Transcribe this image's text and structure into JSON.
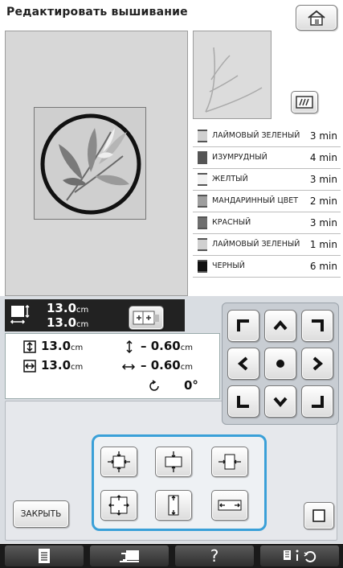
{
  "header": {
    "title": "Редактировать вышивание"
  },
  "colors": [
    {
      "name": "ЛАЙМОВЫЙ ЗЕЛЕНЫЙ",
      "time": "3 min",
      "swatch": "#d0d0d0"
    },
    {
      "name": "ИЗУМРУДНЫЙ",
      "time": "4 min",
      "swatch": "#555555"
    },
    {
      "name": "ЖЕЛТЫЙ",
      "time": "3 min",
      "swatch": "#f2f2f2"
    },
    {
      "name": "МАНДАРИННЫЙ ЦВЕТ",
      "time": "2 min",
      "swatch": "#9e9e9e"
    },
    {
      "name": "КРАСНЫЙ",
      "time": "3 min",
      "swatch": "#6e6e6e"
    },
    {
      "name": "ЛАЙМОВЫЙ ЗЕЛЕНЫЙ",
      "time": "1 min",
      "swatch": "#d0d0d0"
    },
    {
      "name": "ЧЕРНЫЙ",
      "time": "6 min",
      "swatch": "#111111"
    }
  ],
  "size": {
    "width": "13.0",
    "height": "13.0",
    "unit": "cm"
  },
  "measure": {
    "height": "13.0",
    "width": "13.0",
    "unit": "cm",
    "vertical_offset": "– 0.60",
    "horizontal_offset": "– 0.60",
    "rotation": "0°"
  },
  "buttons": {
    "close": "ЗАКРЫТЬ",
    "help": "?"
  }
}
